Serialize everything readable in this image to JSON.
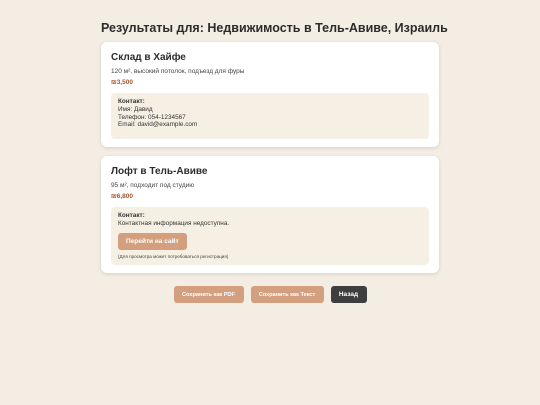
{
  "header": {
    "title": "Результаты для: Недвижимость в Тель-Авиве, Израиль"
  },
  "listings": [
    {
      "title": "Склад в Хайфе",
      "description": "120 м², высокий потолок, подъезд для фуры",
      "price": "₪3,500",
      "contact": {
        "heading": "Контакт:",
        "name": "Имя: Давид",
        "phone": "Телефон: 054-1234567",
        "email": "Email: david@example.com"
      }
    },
    {
      "title": "Лофт в Тель-Авиве",
      "description": "95 м², подходит под студию",
      "price": "₪6,800",
      "contact": {
        "heading": "Контакт:",
        "unavailable": "Контактная информация недоступна.",
        "button_label": "Перейти на сайт",
        "note": "(Для просмотра может потребоваться регистрация)"
      }
    }
  ],
  "actions": {
    "save_pdf": "Сохранить как PDF",
    "save_text": "Сохранить как Текст",
    "back": "Назад"
  },
  "colors": {
    "background": "#f3ede3",
    "price": "#a0582c",
    "accent_button": "#d49f7f",
    "dark_button": "#3e3e3e",
    "contact_box": "#f6f0e4"
  }
}
